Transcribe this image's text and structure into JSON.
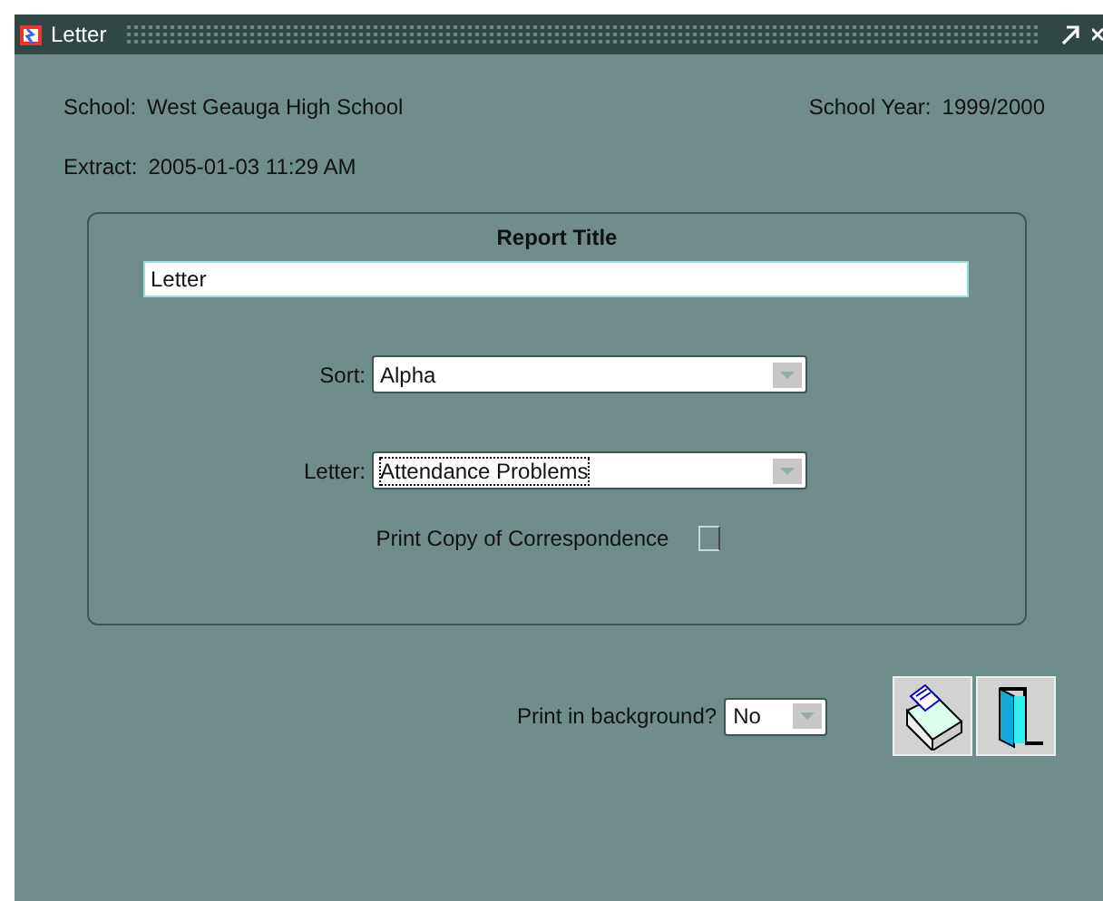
{
  "window": {
    "title": "Letter"
  },
  "header": {
    "school_label": "School:",
    "school": "West Geauga High School",
    "year_label": "School Year:",
    "year": "1999/2000",
    "extract_label": "Extract:",
    "extract": "2005-01-03 11:29 AM"
  },
  "panel": {
    "title": "Report Title",
    "report_title": "Letter",
    "selects": [
      {
        "label": "Sort:",
        "value": "Alpha",
        "focused": false
      },
      {
        "label": "Letter:",
        "value": "Attendance Problems",
        "focused": true
      }
    ],
    "print_copy": {
      "label": "Print Copy of Correspondence",
      "checked": false
    }
  },
  "background": {
    "label": "Print in background?",
    "value": "No"
  }
}
